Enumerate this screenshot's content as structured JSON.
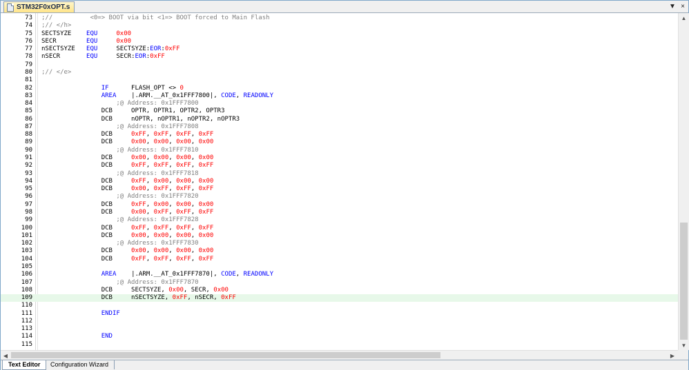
{
  "tab": {
    "filename": "STM32F0xOPT.s",
    "icon": "file-icon"
  },
  "window_buttons": {
    "dropdown": "▼",
    "close": "×"
  },
  "bottom_tabs": [
    {
      "label": "Text Editor"
    },
    {
      "label": "Configuration Wizard"
    }
  ],
  "colors": {
    "keyword": "#0000ff",
    "number": "#ff0000",
    "comment": "#808080",
    "current_line": "#e7f8e9"
  },
  "current_line": 109,
  "lines": [
    {
      "n": "73",
      "tokens": [
        [
          "c",
          ";//          <0=> BOOT via bit <1=> BOOT forced to Main Flash"
        ]
      ]
    },
    {
      "n": "74",
      "tokens": [
        [
          "c",
          ";// </h>"
        ]
      ]
    },
    {
      "n": "75",
      "tokens": [
        [
          "t",
          "SECTSYZE    "
        ],
        [
          "k",
          "EQU"
        ],
        [
          "t",
          "     "
        ],
        [
          "n",
          "0x00"
        ]
      ]
    },
    {
      "n": "76",
      "tokens": [
        [
          "t",
          "SECR        "
        ],
        [
          "k",
          "EQU"
        ],
        [
          "t",
          "     "
        ],
        [
          "n",
          "0x00"
        ]
      ]
    },
    {
      "n": "77",
      "tokens": [
        [
          "t",
          "nSECTSYZE   "
        ],
        [
          "k",
          "EQU"
        ],
        [
          "t",
          "     SECTSYZE:"
        ],
        [
          "k",
          "EOR"
        ],
        [
          "t",
          ":"
        ],
        [
          "n",
          "0xFF"
        ]
      ]
    },
    {
      "n": "78",
      "tokens": [
        [
          "t",
          "nSECR       "
        ],
        [
          "k",
          "EQU"
        ],
        [
          "t",
          "     SECR:"
        ],
        [
          "k",
          "EOR"
        ],
        [
          "t",
          ":"
        ],
        [
          "n",
          "0xFF"
        ]
      ]
    },
    {
      "n": "79",
      "tokens": []
    },
    {
      "n": "80",
      "tokens": [
        [
          "c",
          ";// </e>"
        ]
      ]
    },
    {
      "n": "81",
      "tokens": []
    },
    {
      "n": "82",
      "tokens": [
        [
          "t",
          "                "
        ],
        [
          "k",
          "IF"
        ],
        [
          "t",
          "      FLASH_OPT <> "
        ],
        [
          "n",
          "0"
        ]
      ]
    },
    {
      "n": "83",
      "tokens": [
        [
          "t",
          "                "
        ],
        [
          "k",
          "AREA"
        ],
        [
          "t",
          "    |.ARM.__AT_0x1FFF7800|, "
        ],
        [
          "k",
          "CODE"
        ],
        [
          "t",
          ", "
        ],
        [
          "k",
          "READONLY"
        ]
      ]
    },
    {
      "n": "84",
      "tokens": [
        [
          "t",
          "                    "
        ],
        [
          "c",
          ";@ Address: 0x1FFF7800"
        ]
      ]
    },
    {
      "n": "85",
      "tokens": [
        [
          "t",
          "                DCB     OPTR, OPTR1, OPTR2, OPTR3"
        ]
      ]
    },
    {
      "n": "86",
      "tokens": [
        [
          "t",
          "                DCB     nOPTR, nOPTR1, nOPTR2, nOPTR3"
        ]
      ]
    },
    {
      "n": "87",
      "tokens": [
        [
          "t",
          "                    "
        ],
        [
          "c",
          ";@ Address: 0x1FFF7808"
        ]
      ]
    },
    {
      "n": "88",
      "tokens": [
        [
          "t",
          "                DCB     "
        ],
        [
          "n",
          "0xFF"
        ],
        [
          "t",
          ", "
        ],
        [
          "n",
          "0xFF"
        ],
        [
          "t",
          ", "
        ],
        [
          "n",
          "0xFF"
        ],
        [
          "t",
          ", "
        ],
        [
          "n",
          "0xFF"
        ]
      ]
    },
    {
      "n": "89",
      "tokens": [
        [
          "t",
          "                DCB     "
        ],
        [
          "n",
          "0x00"
        ],
        [
          "t",
          ", "
        ],
        [
          "n",
          "0x00"
        ],
        [
          "t",
          ", "
        ],
        [
          "n",
          "0x00"
        ],
        [
          "t",
          ", "
        ],
        [
          "n",
          "0x00"
        ]
      ]
    },
    {
      "n": "90",
      "tokens": [
        [
          "t",
          "                    "
        ],
        [
          "c",
          ";@ Address: 0x1FFF7810"
        ]
      ]
    },
    {
      "n": "91",
      "tokens": [
        [
          "t",
          "                DCB     "
        ],
        [
          "n",
          "0x00"
        ],
        [
          "t",
          ", "
        ],
        [
          "n",
          "0x00"
        ],
        [
          "t",
          ", "
        ],
        [
          "n",
          "0x00"
        ],
        [
          "t",
          ", "
        ],
        [
          "n",
          "0x00"
        ]
      ]
    },
    {
      "n": "92",
      "tokens": [
        [
          "t",
          "                DCB     "
        ],
        [
          "n",
          "0xFF"
        ],
        [
          "t",
          ", "
        ],
        [
          "n",
          "0xFF"
        ],
        [
          "t",
          ", "
        ],
        [
          "n",
          "0xFF"
        ],
        [
          "t",
          ", "
        ],
        [
          "n",
          "0xFF"
        ]
      ]
    },
    {
      "n": "93",
      "tokens": [
        [
          "t",
          "                    "
        ],
        [
          "c",
          ";@ Address: 0x1FFF7818"
        ]
      ]
    },
    {
      "n": "94",
      "tokens": [
        [
          "t",
          "                DCB     "
        ],
        [
          "n",
          "0xFF"
        ],
        [
          "t",
          ", "
        ],
        [
          "n",
          "0x00"
        ],
        [
          "t",
          ", "
        ],
        [
          "n",
          "0x00"
        ],
        [
          "t",
          ", "
        ],
        [
          "n",
          "0x00"
        ]
      ]
    },
    {
      "n": "95",
      "tokens": [
        [
          "t",
          "                DCB     "
        ],
        [
          "n",
          "0x00"
        ],
        [
          "t",
          ", "
        ],
        [
          "n",
          "0xFF"
        ],
        [
          "t",
          ", "
        ],
        [
          "n",
          "0xFF"
        ],
        [
          "t",
          ", "
        ],
        [
          "n",
          "0xFF"
        ]
      ]
    },
    {
      "n": "96",
      "tokens": [
        [
          "t",
          "                    "
        ],
        [
          "c",
          ";@ Address: 0x1FFF7820"
        ]
      ]
    },
    {
      "n": "97",
      "tokens": [
        [
          "t",
          "                DCB     "
        ],
        [
          "n",
          "0xFF"
        ],
        [
          "t",
          ", "
        ],
        [
          "n",
          "0x00"
        ],
        [
          "t",
          ", "
        ],
        [
          "n",
          "0x00"
        ],
        [
          "t",
          ", "
        ],
        [
          "n",
          "0x00"
        ]
      ]
    },
    {
      "n": "98",
      "tokens": [
        [
          "t",
          "                DCB     "
        ],
        [
          "n",
          "0x00"
        ],
        [
          "t",
          ", "
        ],
        [
          "n",
          "0xFF"
        ],
        [
          "t",
          ", "
        ],
        [
          "n",
          "0xFF"
        ],
        [
          "t",
          ", "
        ],
        [
          "n",
          "0xFF"
        ]
      ]
    },
    {
      "n": "99",
      "tokens": [
        [
          "t",
          "                    "
        ],
        [
          "c",
          ";@ Address: 0x1FFF7828"
        ]
      ]
    },
    {
      "n": "100",
      "tokens": [
        [
          "t",
          "                DCB     "
        ],
        [
          "n",
          "0xFF"
        ],
        [
          "t",
          ", "
        ],
        [
          "n",
          "0xFF"
        ],
        [
          "t",
          ", "
        ],
        [
          "n",
          "0xFF"
        ],
        [
          "t",
          ", "
        ],
        [
          "n",
          "0xFF"
        ]
      ]
    },
    {
      "n": "101",
      "tokens": [
        [
          "t",
          "                DCB     "
        ],
        [
          "n",
          "0x00"
        ],
        [
          "t",
          ", "
        ],
        [
          "n",
          "0x00"
        ],
        [
          "t",
          ", "
        ],
        [
          "n",
          "0x00"
        ],
        [
          "t",
          ", "
        ],
        [
          "n",
          "0x00"
        ]
      ]
    },
    {
      "n": "102",
      "tokens": [
        [
          "t",
          "                    "
        ],
        [
          "c",
          ";@ Address: 0x1FFF7830"
        ]
      ]
    },
    {
      "n": "103",
      "tokens": [
        [
          "t",
          "                DCB     "
        ],
        [
          "n",
          "0x00"
        ],
        [
          "t",
          ", "
        ],
        [
          "n",
          "0x00"
        ],
        [
          "t",
          ", "
        ],
        [
          "n",
          "0x00"
        ],
        [
          "t",
          ", "
        ],
        [
          "n",
          "0x00"
        ]
      ]
    },
    {
      "n": "104",
      "tokens": [
        [
          "t",
          "                DCB     "
        ],
        [
          "n",
          "0xFF"
        ],
        [
          "t",
          ", "
        ],
        [
          "n",
          "0xFF"
        ],
        [
          "t",
          ", "
        ],
        [
          "n",
          "0xFF"
        ],
        [
          "t",
          ", "
        ],
        [
          "n",
          "0xFF"
        ]
      ]
    },
    {
      "n": "105",
      "tokens": []
    },
    {
      "n": "106",
      "tokens": [
        [
          "t",
          "                "
        ],
        [
          "k",
          "AREA"
        ],
        [
          "t",
          "    |.ARM.__AT_0x1FFF7870|, "
        ],
        [
          "k",
          "CODE"
        ],
        [
          "t",
          ", "
        ],
        [
          "k",
          "READONLY"
        ]
      ]
    },
    {
      "n": "107",
      "tokens": [
        [
          "t",
          "                    "
        ],
        [
          "c",
          ";@ Address: 0x1FFF7870"
        ]
      ]
    },
    {
      "n": "108",
      "tokens": [
        [
          "t",
          "                DCB     SECTSYZE, "
        ],
        [
          "n",
          "0x00"
        ],
        [
          "t",
          ", SECR, "
        ],
        [
          "n",
          "0x00"
        ]
      ]
    },
    {
      "n": "109",
      "tokens": [
        [
          "t",
          "                DCB     nSECTSYZE, "
        ],
        [
          "n",
          "0xFF"
        ],
        [
          "t",
          ", nSECR, "
        ],
        [
          "n",
          "0xFF"
        ]
      ]
    },
    {
      "n": "110",
      "tokens": []
    },
    {
      "n": "111",
      "tokens": [
        [
          "t",
          "                "
        ],
        [
          "k",
          "ENDIF"
        ]
      ]
    },
    {
      "n": "112",
      "tokens": []
    },
    {
      "n": "113",
      "tokens": []
    },
    {
      "n": "114",
      "tokens": [
        [
          "t",
          "                "
        ],
        [
          "k",
          "END"
        ]
      ]
    },
    {
      "n": "115",
      "tokens": []
    }
  ]
}
